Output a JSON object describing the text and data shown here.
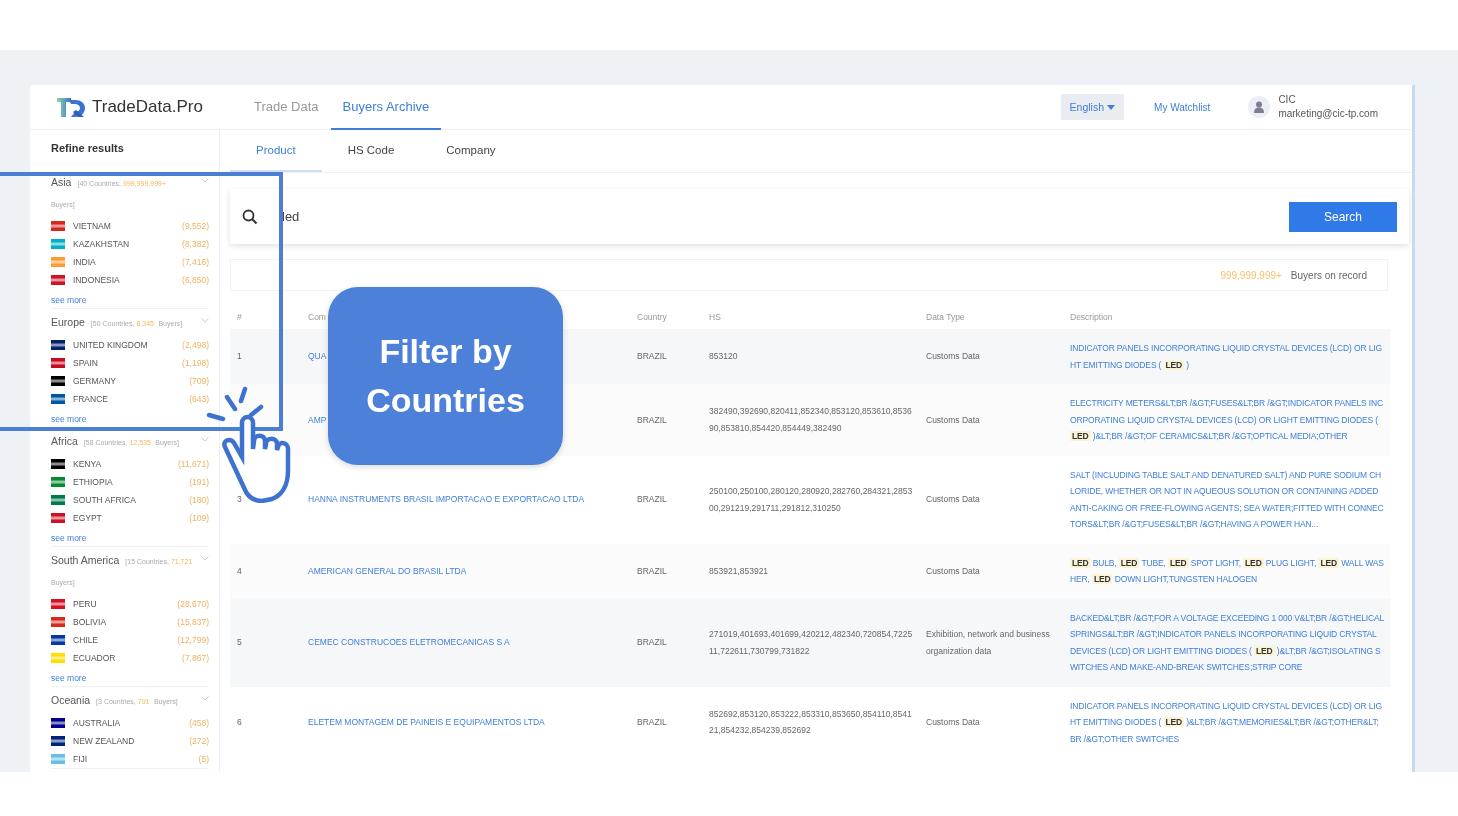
{
  "brand": {
    "name": "TradeData.Pro"
  },
  "nav_tabs": [
    {
      "label": "Trade Data",
      "selected": false
    },
    {
      "label": "Buyers Archive",
      "selected": true
    }
  ],
  "header_actions": {
    "language": "English",
    "watchlist": "My Watchlist",
    "user_name": "CIC",
    "user_email": "marketing@cic-tp.com"
  },
  "sidebar": {
    "title": "Refine results",
    "regions": [
      {
        "name": "Asia",
        "countries": "[40 Countries,",
        "buyers": "999,999,999+",
        "suffix": "Buyers]",
        "more": "see more",
        "items": [
          {
            "name": "VIETNAM",
            "count": "(9,552)",
            "color": "#da251d"
          },
          {
            "name": "KAZAKHSTAN",
            "count": "(8,382)",
            "color": "#00afca"
          },
          {
            "name": "INDIA",
            "count": "(7,416)",
            "color": "#ff9933"
          },
          {
            "name": "INDONESIA",
            "count": "(6,850)",
            "color": "#ce1126"
          }
        ]
      },
      {
        "name": "Europe",
        "countries": "[50 Countries,",
        "buyers": "8,345",
        "suffix": "Buyers]",
        "more": "see more",
        "items": [
          {
            "name": "UNITED KINGDOM",
            "count": "(2,498)",
            "color": "#012169"
          },
          {
            "name": "SPAIN",
            "count": "(1,198)",
            "color": "#c60b1e"
          },
          {
            "name": "GERMANY",
            "count": "(709)",
            "color": "#000000"
          },
          {
            "name": "FRANCE",
            "count": "(643)",
            "color": "#0055a4"
          }
        ]
      },
      {
        "name": "Africa",
        "countries": "[58 Countries,",
        "buyers": "12,535",
        "suffix": "Buyers]",
        "more": "see more",
        "items": [
          {
            "name": "KENYA",
            "count": "(11,671)",
            "color": "#000000"
          },
          {
            "name": "ETHIOPIA",
            "count": "(191)",
            "color": "#078930"
          },
          {
            "name": "SOUTH AFRICA",
            "count": "(180)",
            "color": "#007a4d"
          },
          {
            "name": "EGYPT",
            "count": "(109)",
            "color": "#ce1126"
          }
        ]
      },
      {
        "name": "South America",
        "countries": "[15 Countries,",
        "buyers": "71,721",
        "suffix": "Buyers]",
        "more": "see more",
        "items": [
          {
            "name": "PERU",
            "count": "(28,670)",
            "color": "#d91023"
          },
          {
            "name": "BOLIVIA",
            "count": "(15,837)",
            "color": "#d52b1e"
          },
          {
            "name": "CHILE",
            "count": "(12,799)",
            "color": "#0039a6"
          },
          {
            "name": "ECUADOR",
            "count": "(7,867)",
            "color": "#ffdd00"
          }
        ]
      },
      {
        "name": "Oceania",
        "countries": "[3 Countries,",
        "buyers": "791",
        "suffix": "Buyers]",
        "items": [
          {
            "name": "AUSTRALIA",
            "count": "(458)",
            "color": "#00008b"
          },
          {
            "name": "NEW ZEALAND",
            "count": "(272)",
            "color": "#00247d"
          },
          {
            "name": "FIJI",
            "count": "(5)",
            "color": "#68bfe5"
          }
        ]
      }
    ]
  },
  "search_tabs": [
    {
      "label": "Product",
      "selected": true
    },
    {
      "label": "HS Code",
      "selected": false
    },
    {
      "label": "Company",
      "selected": false
    }
  ],
  "search": {
    "value": "led",
    "button": "Search"
  },
  "summary": {
    "count": "999,999,999+",
    "label": "Buyers on record"
  },
  "table": {
    "columns": [
      "#",
      "Com",
      "Country",
      "HS",
      "Data Type",
      "Description"
    ],
    "rows": [
      {
        "index": "1",
        "company": "QUA",
        "country": "BRAZIL",
        "hs": "853120",
        "data_type": "Customs Data",
        "description": "INDICATOR PANELS INCORPORATING LIQUID CRYSTAL DEVICES (LCD) OR LIGHT EMITTING DIODES ( **LED** )"
      },
      {
        "company": "AMP",
        "country": "BRAZIL",
        "hs": "382490,392690,820411,852340,853120,853610,853690,853810,854420,854449,382490",
        "data_type": "Customs Data",
        "description": "ELECTRICITY METERS&LT;BR /&GT;FUSES&LT;BR /&GT;INDICATOR PANELS INCORPORATING LIQUID CRYSTAL DEVICES (LCD) OR LIGHT EMITTING DIODES ( **LED** )&LT;BR /&GT;OF CERAMICS&LT;BR /&GT;OPTICAL MEDIA;OTHER"
      },
      {
        "index": "3",
        "company": "HANNA INSTRUMENTS BRASIL IMPORTACAO E EXPORTACAO LTDA",
        "country": "BRAZIL",
        "hs": "250100,250100,280120,280920,282760,284321,285300,291219,291711,291812,310250",
        "data_type": "Customs Data",
        "description": "SALT (INCLUDING TABLE SALT AND DENATURED SALT) AND PURE SODIUM CHLORIDE, WHETHER OR NOT IN AQUEOUS SOLUTION OR CONTAINING ADDED ANTI-CAKING OR FREE-FLOWING AGENTS; SEA WATER;FITTED WITH CONNECTORS&LT;BR /&GT;FUSES&LT;BR /&GT;HAVING A POWER HAN..."
      },
      {
        "index": "4",
        "company": "AMERICAN GENERAL DO BRASIL LTDA",
        "country": "BRAZIL",
        "hs": "853921,853921",
        "data_type": "Customs Data",
        "description": "**LED** BULB, **LED** TUBE, **LED** SPOT LIGHT, **LED** PLUG LIGHT, **LED** WALL WASHER, **LED** DOWN LIGHT,TUNGSTEN HALOGEN"
      },
      {
        "index": "5",
        "company": "CEMEC CONSTRUCOES ELETROMECANICAS S A",
        "country": "BRAZIL",
        "hs": "271019,401693,401699,420212,482340,720854,722511,722611,730799,731822",
        "data_type": "Exhibition, network and business organization data",
        "description": "BACKED&LT;BR /&GT;FOR A VOLTAGE EXCEEDING 1 000 V&LT;BR /&GT;HELICAL SPRINGS&LT;BR /&GT;INDICATOR PANELS INCORPORATING LIQUID CRYSTAL DEVICES (LCD) OR LIGHT EMITTING DIODES ( **LED** )&LT;BR /&GT;ISOLATING SWITCHES AND MAKE-AND-BREAK SWITCHES;STRIP CORE"
      },
      {
        "index": "6",
        "company": "ELETEM MONTAGEM DE PAINEIS E EQUIPAMENTOS LTDA",
        "country": "BRAZIL",
        "hs": "852692,853120,853222,853310,853650,854110,854121,854232,854239,852692",
        "data_type": "Customs Data",
        "description": "INDICATOR PANELS INCORPORATING LIQUID CRYSTAL DEVICES (LCD) OR LIGHT EMITTING DIODES ( **LED** )&LT;BR /&GT;MEMORIES&LT;BR /&GT;OTHER&LT;BR /&GT;OTHER SWITCHES"
      }
    ]
  },
  "overlay": {
    "callout": "Filter by Countries"
  }
}
